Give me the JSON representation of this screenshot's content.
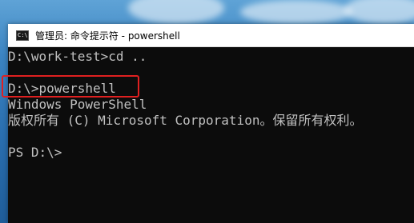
{
  "window": {
    "title": "管理员: 命令提示符 - powershell",
    "icon": "cmd-icon",
    "icon_glyph": "C:\\"
  },
  "console": {
    "lines": [
      "D:\\work-test>cd ..",
      "",
      "D:\\>powershell",
      "Windows PowerShell",
      "版权所有 (C) Microsoft Corporation。保留所有权利。",
      "",
      "PS D:\\>"
    ]
  },
  "colors": {
    "console_bg": "#0c0c0c",
    "console_text": "#c0c0c0",
    "highlight": "#e02020"
  }
}
